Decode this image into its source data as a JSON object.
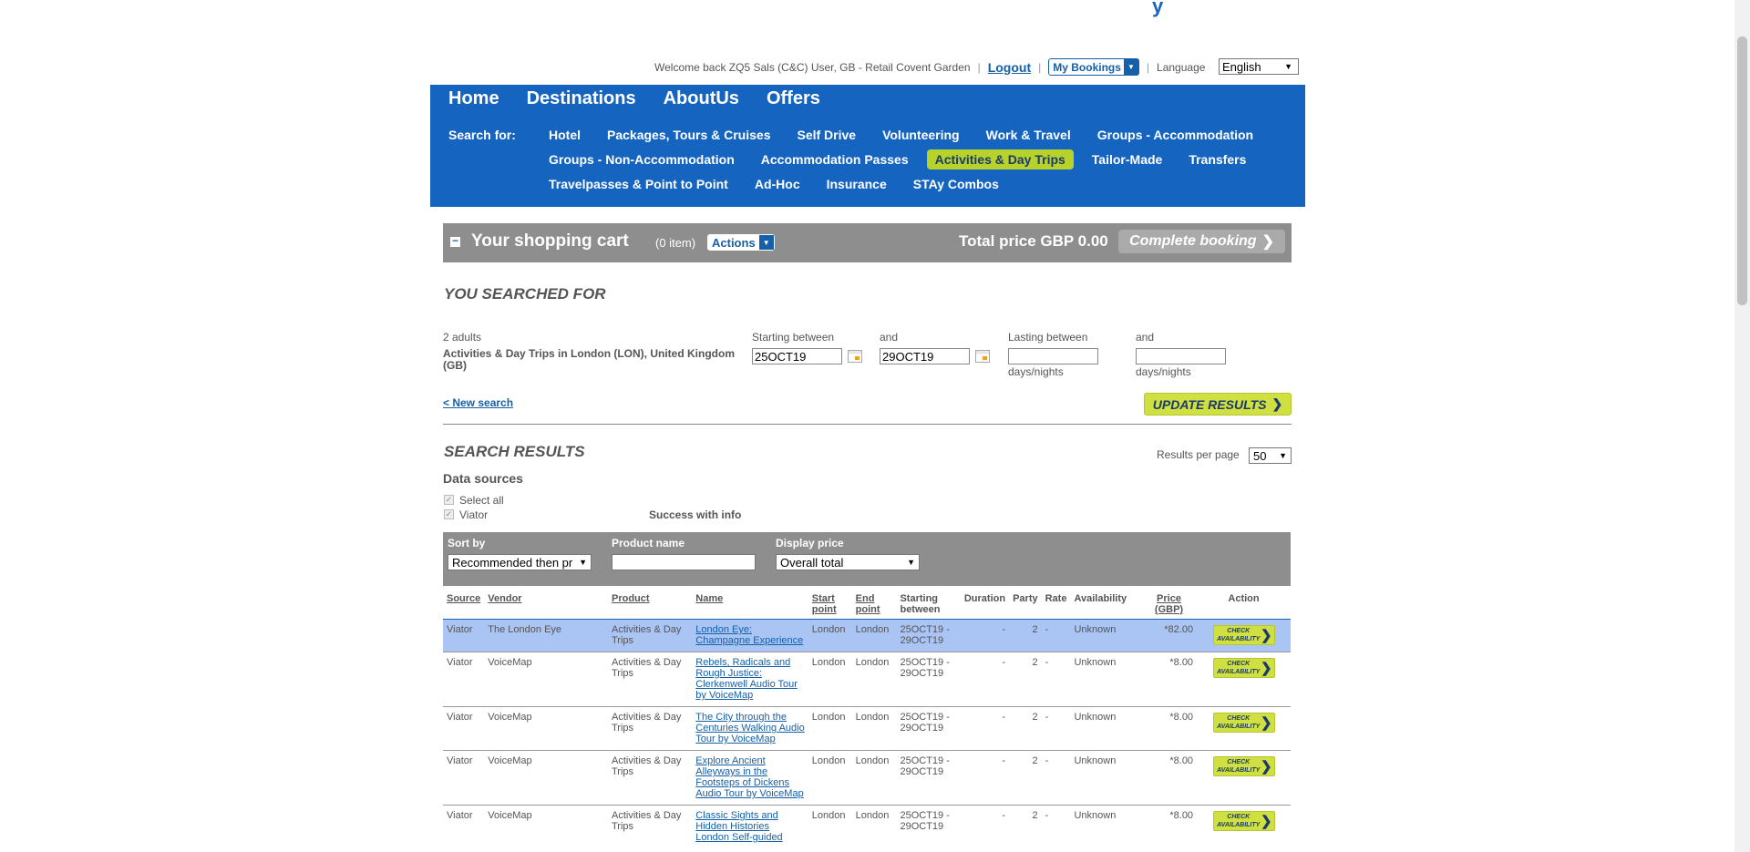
{
  "header": {
    "logo_fragment": "y",
    "welcome_text": "Welcome back ZQ5 Sals (C&C) User, GB - Retail Covent Garden",
    "logout_label": "Logout",
    "my_bookings_label": "My Bookings",
    "language_label": "Language",
    "language_value": "English"
  },
  "nav": {
    "main": [
      "Home",
      "Destinations",
      "AboutUs",
      "Offers"
    ],
    "search_for_label": "Search for:",
    "row1": [
      "Hotel",
      "Packages, Tours & Cruises",
      "Self Drive",
      "Volunteering",
      "Work & Travel",
      "Groups - Accommodation"
    ],
    "row2": [
      "Groups - Non-Accommodation",
      "Accommodation Passes",
      "Activities & Day Trips",
      "Tailor-Made",
      "Transfers"
    ],
    "row3": [
      "Travelpasses & Point to Point",
      "Ad-Hoc",
      "Insurance",
      "STAy Combos"
    ],
    "active": "Activities & Day Trips"
  },
  "cart": {
    "title": "Your shopping cart",
    "items": "(0 item)",
    "actions_label": "Actions",
    "total": "Total price GBP 0.00",
    "complete_label": "Complete booking"
  },
  "search": {
    "title": "YOU SEARCHED FOR",
    "party": "2 adults",
    "location": "Activities & Day Trips in London (LON), United Kingdom (GB)",
    "starting_between_label": "Starting between",
    "and_label": "and",
    "start_date": "25OCT19",
    "end_date": "29OCT19",
    "lasting_between_label": "Lasting between",
    "lasting_and_label": "and",
    "days_nights_1": "days/nights",
    "days_nights_2": "days/nights",
    "new_search_label": "< New search",
    "update_label": "UPDATE RESULTS"
  },
  "results": {
    "title": "SEARCH RESULTS",
    "per_page_label": "Results per page",
    "per_page_value": "50",
    "data_sources_label": "Data sources",
    "select_all_label": "Select all",
    "viator_label": "Viator",
    "status_text": "Success with info",
    "sort_by_label": "Sort by",
    "sort_by_value": "Recommended then pr",
    "product_name_label": "Product name",
    "product_name_value": "",
    "display_price_label": "Display price",
    "display_price_value": "Overall total",
    "columns": {
      "source": "Source",
      "vendor": "Vendor",
      "product": "Product",
      "name": "Name",
      "start_point": "Start point",
      "end_point": "End point",
      "starting_between": "Starting between",
      "duration": "Duration",
      "party": "Party",
      "rate": "Rate",
      "availability": "Availability",
      "price": "Price (GBP)",
      "action": "Action"
    },
    "check_label": "CHECK AVAILABILITY",
    "rows": [
      {
        "source": "Viator",
        "vendor": "The London Eye",
        "product": "Activities & Day Trips",
        "name": "London Eye: Champagne Experience",
        "start": "London",
        "end": "London",
        "dates": "25OCT19 - 29OCT19",
        "duration": "-",
        "party": "2",
        "rate": "-",
        "availability": "Unknown",
        "price": "*82.00"
      },
      {
        "source": "Viator",
        "vendor": "VoiceMap",
        "product": "Activities & Day Trips",
        "name": "Rebels, Radicals and Rough Justice: Clerkenwell Audio Tour by VoiceMap",
        "start": "London",
        "end": "London",
        "dates": "25OCT19 - 29OCT19",
        "duration": "-",
        "party": "2",
        "rate": "-",
        "availability": "Unknown",
        "price": "*8.00"
      },
      {
        "source": "Viator",
        "vendor": "VoiceMap",
        "product": "Activities & Day Trips",
        "name": "The City through the Centuries Walking Audio Tour by VoiceMap",
        "start": "London",
        "end": "London",
        "dates": "25OCT19 - 29OCT19",
        "duration": "-",
        "party": "2",
        "rate": "-",
        "availability": "Unknown",
        "price": "*8.00"
      },
      {
        "source": "Viator",
        "vendor": "VoiceMap",
        "product": "Activities & Day Trips",
        "name": "Explore Ancient Alleyways in the Footsteps of Dickens Audio Tour by VoiceMap",
        "start": "London",
        "end": "London",
        "dates": "25OCT19 - 29OCT19",
        "duration": "-",
        "party": "2",
        "rate": "-",
        "availability": "Unknown",
        "price": "*8.00"
      },
      {
        "source": "Viator",
        "vendor": "VoiceMap",
        "product": "Activities & Day Trips",
        "name": "Classic Sights and Hidden Histories London Self-guided",
        "start": "London",
        "end": "London",
        "dates": "25OCT19 - 29OCT19",
        "duration": "-",
        "party": "2",
        "rate": "-",
        "availability": "Unknown",
        "price": "*8.00"
      }
    ]
  }
}
